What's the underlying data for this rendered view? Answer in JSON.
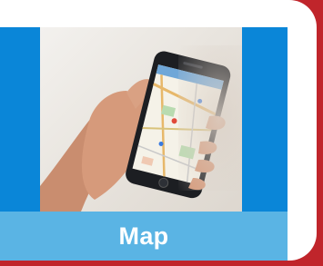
{
  "tile": {
    "label": "Map",
    "icon": "phone-map-photo"
  },
  "colors": {
    "outer_border": "#c0252b",
    "tile_blue": "#0a86d8",
    "label_bar": "#5ab4e4",
    "label_text": "#ffffff"
  }
}
